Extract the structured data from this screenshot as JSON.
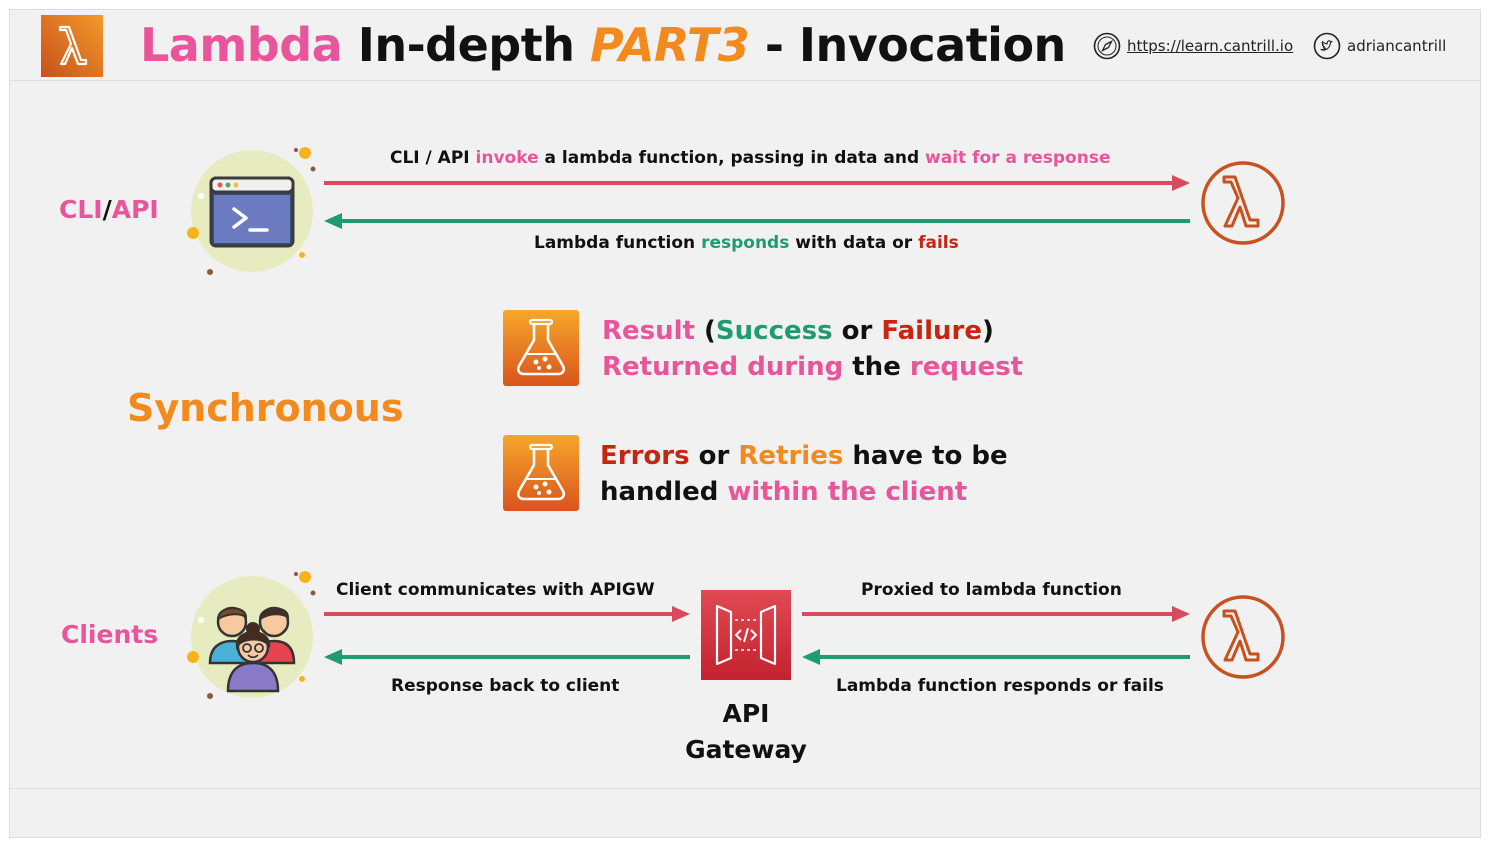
{
  "header": {
    "title_part1": "Lambda",
    "title_part2": "In-depth",
    "title_part3": "PART3",
    "title_part4": "- Invocation",
    "url": "https://learn.cantrill.io",
    "twitter": "adriancantrill"
  },
  "top_flow": {
    "side_label_a": "CLI",
    "side_label_sep": "/",
    "side_label_b": "API",
    "request": {
      "t1": "CLI / API ",
      "t2": "invoke",
      "t3": " a lambda function, passing in data and ",
      "t4": "wait for a response"
    },
    "response": {
      "t1": "Lambda function ",
      "t2": "responds",
      "t3": " with data or ",
      "t4": "fails"
    }
  },
  "synchronous_label": "Synchronous",
  "points": {
    "p1": {
      "a": "Result",
      "b": " (",
      "c": "Success",
      "d": " or ",
      "e": "Failure",
      "f": ")",
      "g": "Returned during",
      "h": " the ",
      "i": "request"
    },
    "p2": {
      "a": "Errors",
      "b": " or ",
      "c": "Retries",
      "d": " have to be",
      "e": "handled ",
      "f": "within the client"
    }
  },
  "bottom_flow": {
    "side_label": "Clients",
    "client_to_apigw": "Client communicates with APIGW",
    "apigw_to_client": "Response back to client",
    "apigw_to_lambda": "Proxied to lambda function",
    "lambda_to_apigw": "Lambda function responds or fails",
    "apigw_label_1": "API",
    "apigw_label_2": "Gateway"
  },
  "colors": {
    "pink": "#e8559a",
    "orange": "#f28a1e",
    "green": "#1f9b6e",
    "red": "#c5260f",
    "request_arrow": "#d94a5e",
    "response_arrow": "#1f9b6e",
    "lambda_ring": "#c7511f"
  },
  "icons": [
    "lambda-logo-icon",
    "compass-icon",
    "twitter-icon",
    "terminal-icon",
    "lambda-icon",
    "flask-icon",
    "users-icon",
    "api-gateway-icon"
  ]
}
